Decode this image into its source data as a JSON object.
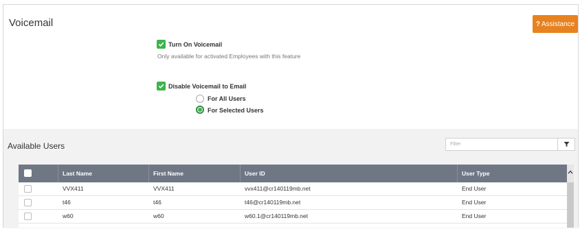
{
  "page": {
    "title": "Voicemail"
  },
  "assistance": {
    "icon": "?",
    "label": "Assistance"
  },
  "voicemail": {
    "turn_on_label": "Turn On Voicemail",
    "turn_on_checked": true,
    "turn_on_note": "Only available for activated Employees with this feature",
    "disable_email_label": "Disable Voicemail to Email",
    "disable_email_checked": true,
    "radio_all": "For All Users",
    "radio_selected": "For Selected Users",
    "radio_value": "For Selected Users"
  },
  "available_users": {
    "title": "Available Users",
    "filter_placeholder": "Filter",
    "columns": [
      "Last Name",
      "First Name",
      "User ID",
      "User Type"
    ],
    "rows": [
      {
        "last": "VVX411",
        "first": "VVX411",
        "user_id": "vvx411@cr140119mb.net",
        "type": "End User"
      },
      {
        "last": "t46",
        "first": "t46",
        "user_id": "t46@cr140119mb.net",
        "type": "End User"
      },
      {
        "last": "w60",
        "first": "w60",
        "user_id": "w60.1@cr140119mb.net",
        "type": "End User"
      }
    ]
  },
  "colors": {
    "accent_orange": "#e8821f",
    "check_green": "#3cb44b",
    "header_gray": "#6f7785"
  }
}
